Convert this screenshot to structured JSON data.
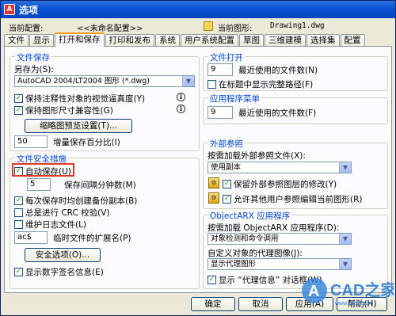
{
  "window": {
    "title": "选项"
  },
  "config": {
    "current_config_label": "当前配置:",
    "current_config_value": "<<未命名配置>>",
    "current_drawing_label": "当前图形:",
    "current_drawing_value": "Drawing1.dwg"
  },
  "tabs": [
    "文件",
    "显示",
    "打开和保存",
    "打印和发布",
    "系统",
    "用户系统配置",
    "草图",
    "三维建模",
    "选择集",
    "配置"
  ],
  "active_tab": "打开和保存",
  "file_save": {
    "group_label": "文件保存",
    "save_as_label": "另存为(S):",
    "save_as_value": "AutoCAD 2004/LT2004 图形 (*.dwg)",
    "cb_visual_fidelity": "保持注释性对象的视觉逼真度(Y)",
    "cb_size_compat": "保持图形尺寸兼容性(G)",
    "thumbnail_button": "缩略图预览设置(T)...",
    "increment_value": "50",
    "increment_label": "增量保存百分比(I)"
  },
  "safety": {
    "group_label": "文件安全措施",
    "autosave_label": "自动保存(U)",
    "interval_value": "5",
    "interval_label": "保存间隔分钟数(M)",
    "backup_label": "每次保存时均创建备份副本(B)",
    "crc_label": "总是进行 CRC 校验(V)",
    "log_label": "维护日志文件(L)",
    "ext_value": "ac$",
    "ext_label": "临时文件的扩展名(P)",
    "security_button": "安全选项(O)...",
    "signature_label": "显示数字签名信息(E)"
  },
  "file_open": {
    "group_label": "文件打开",
    "recent_value": "9",
    "recent_label": "最近使用的文件数(N)",
    "fullpath_label": "在标题中显示完整路径(F)"
  },
  "app_menu": {
    "group_label": "应用程序菜单",
    "recent_value": "9",
    "recent_label": "最近使用的文件数(F)"
  },
  "xref": {
    "group_label": "外部参照",
    "demand_label": "按需加载外部参照文件(X):",
    "demand_value": "使用副本",
    "retain_label": "保留外部参照图层的修改(Y)",
    "allow_label": "允许其他用户参照编辑当前图形(R)"
  },
  "objectarx": {
    "group_label": "ObjectARX 应用程序",
    "demand_label": "按需加载 ObjectARX 应用程序(D):",
    "demand_value": "对象检测和命令调用",
    "proxy_label": "自定义对象的代理图像(J):",
    "proxy_value": "显示代理图形",
    "proxy_info_label": "显示 “代理信息” 对话框(W)"
  },
  "buttons": {
    "ok": "确定",
    "cancel": "取消",
    "apply": "应用(A)",
    "help": "帮助(H)"
  },
  "watermark": {
    "text": "CAD之家",
    "sub": "www.cadzj.com"
  }
}
